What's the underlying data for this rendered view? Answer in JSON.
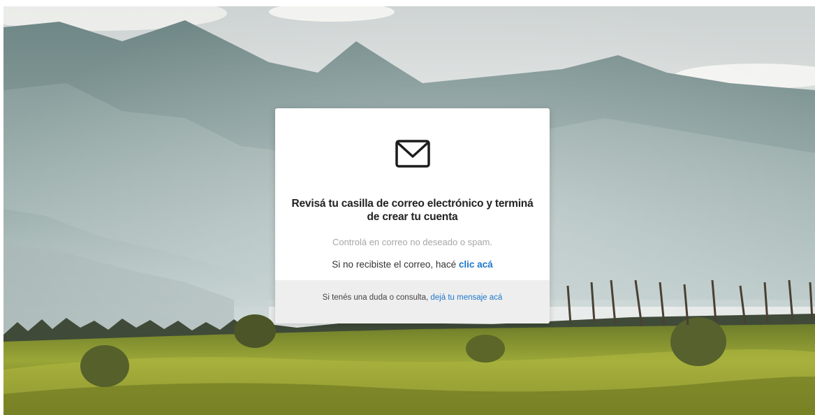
{
  "background": {
    "description_colors": {
      "sky": "#e6e9e8",
      "mountains": "#7f9896",
      "vineyard": "#8c9a2c"
    }
  },
  "card": {
    "icon": "envelope-icon",
    "title_line1": "Revisá tu casilla de correo electrónico y terminá",
    "title_line2": "de crear tu cuenta",
    "hint": "Controlá en correo no deseado o spam.",
    "resend_prefix": "Si no recibiste el correo, hacé ",
    "resend_link": "clic acá",
    "footer_prefix": "Si tenés una duda o consulta, ",
    "footer_link": "dejá tu mensaje acá",
    "link_color": "#1f77c9"
  }
}
